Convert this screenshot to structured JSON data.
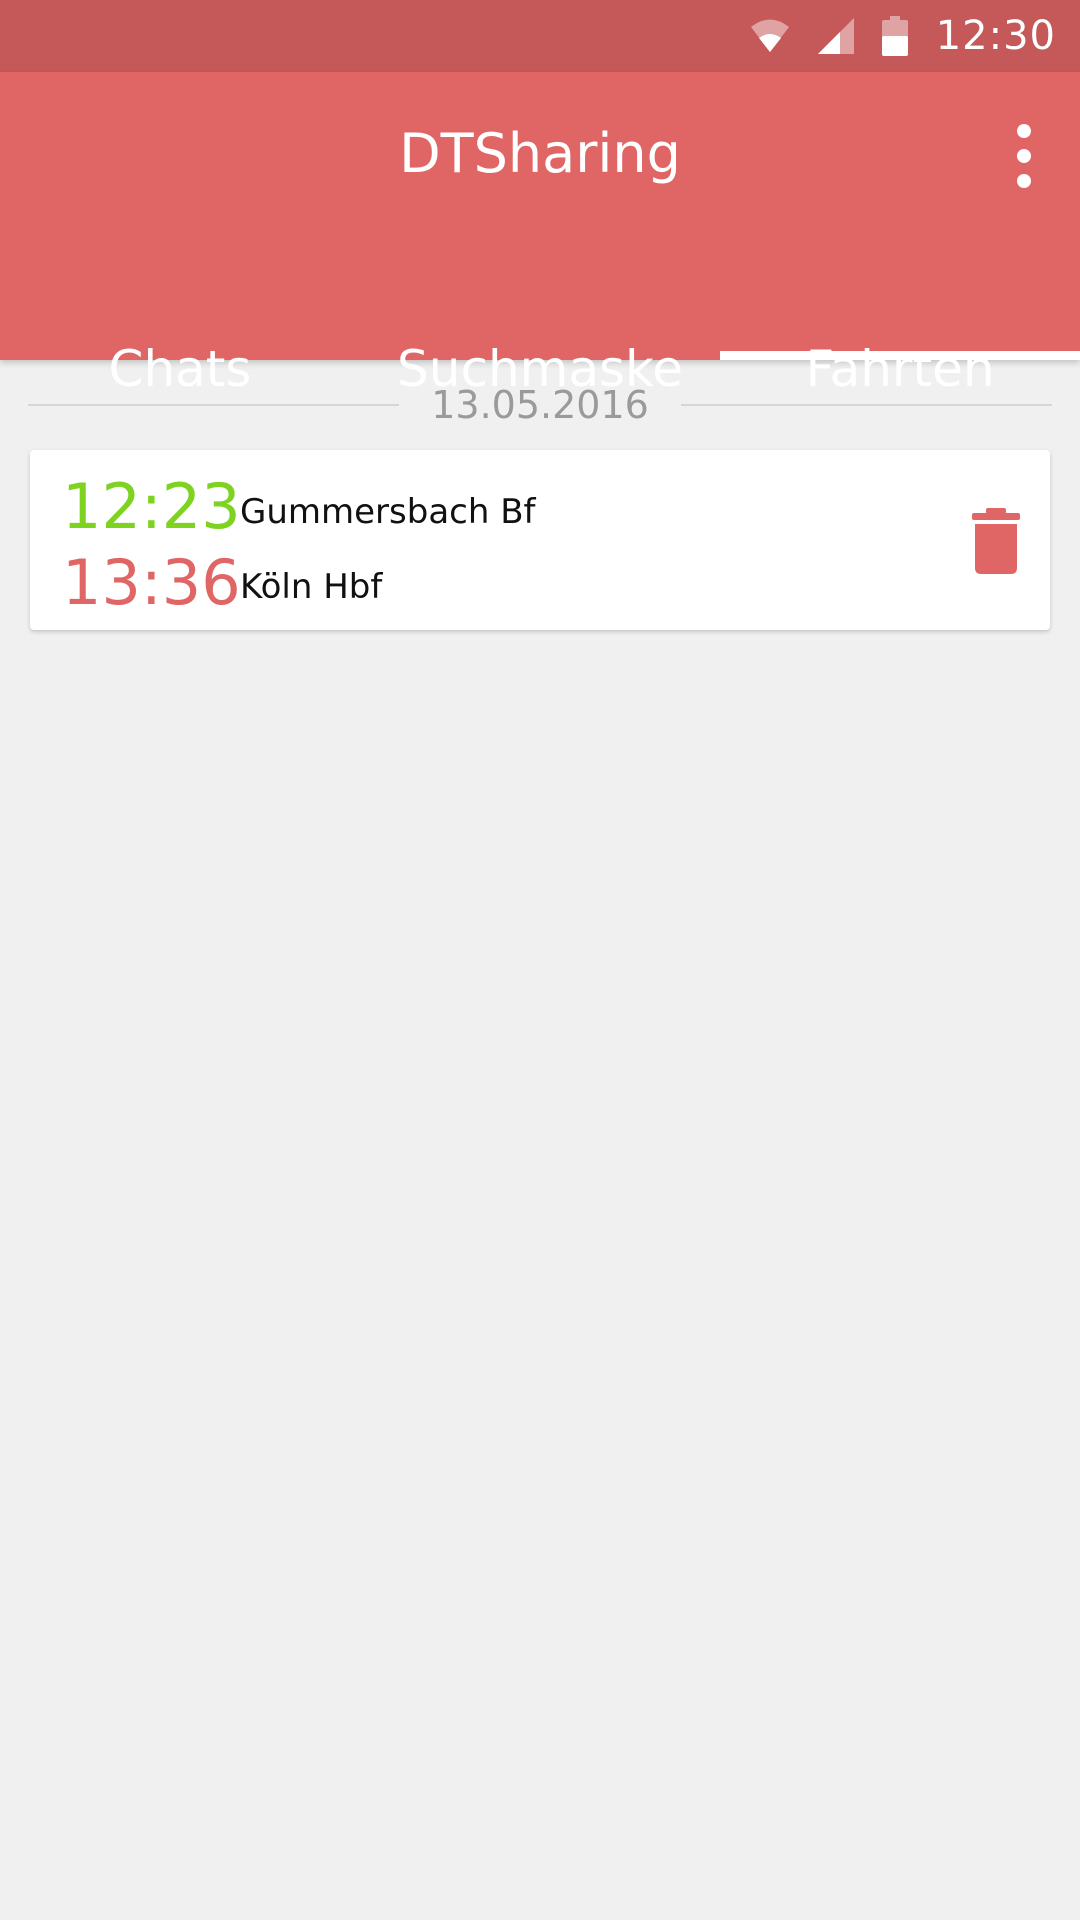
{
  "status_bar": {
    "time": "12:30",
    "icons": [
      "wifi-icon",
      "cell-signal-icon",
      "battery-icon"
    ]
  },
  "app_bar": {
    "title": "DTSharing",
    "menu_icon": "more-vertical-icon"
  },
  "tabs": [
    {
      "label": "Chats",
      "active": false
    },
    {
      "label": "Suchmaske",
      "active": false
    },
    {
      "label": "Fahrten",
      "active": true
    }
  ],
  "trips": {
    "date": "13.05.2016",
    "items": [
      {
        "departure_time": "12:23",
        "departure_station": "Gummersbach Bf",
        "arrival_time": "13:36",
        "arrival_station": "Köln Hbf",
        "action_icon": "trash-icon"
      }
    ]
  },
  "colors": {
    "status_bar": "#c55858",
    "primary": "#e06666",
    "departure_time": "#7ed321",
    "arrival_time": "#e06666",
    "background": "#f0f0f0"
  }
}
